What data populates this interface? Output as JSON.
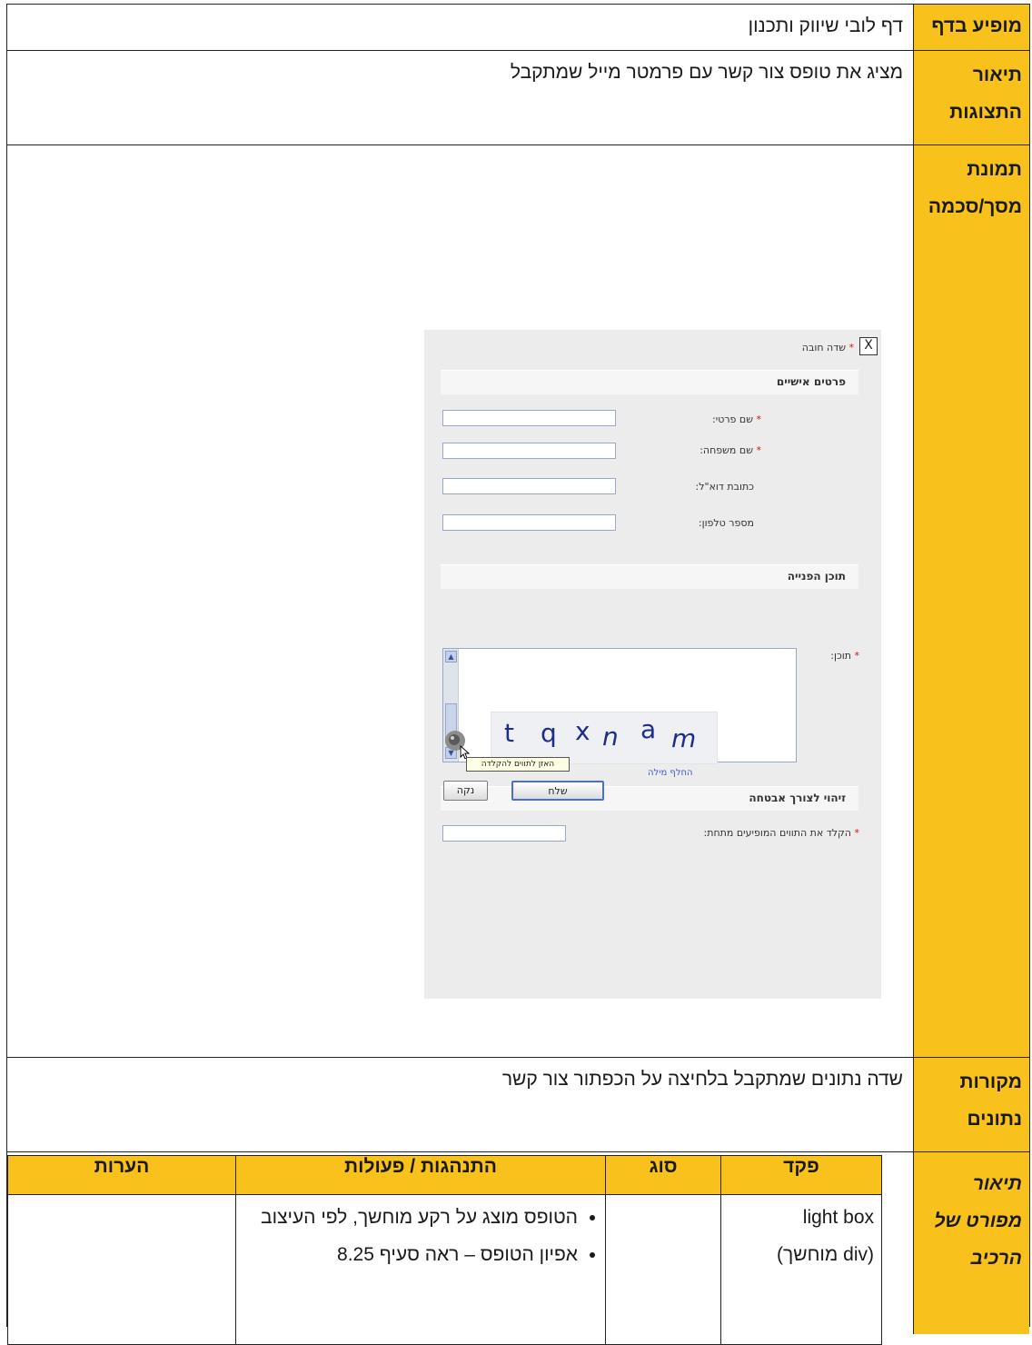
{
  "rows": {
    "appears_in": {
      "label": "מופיע בדף",
      "value": "דף לובי שיווק ותכנון"
    },
    "behaviors": {
      "label1": "תיאור",
      "label2": "התצוגות",
      "value": "מציג את טופס צור קשר עם פרמטר מייל שמתקבל"
    },
    "screenshot": {
      "label1": "תמונת",
      "label2": "מסך/סכמה"
    },
    "data_sources": {
      "label1": "מקורות",
      "label2": "נתונים",
      "value": "שדה נתונים שמתקבל בלחיצה על הכפתור צור קשר"
    },
    "detail": {
      "label1": "תיאור",
      "label2": "מפורט של",
      "label3": "הרכיב"
    }
  },
  "form": {
    "close": "X",
    "required_note": "שדה חובה",
    "personal_section": "פרטים אישיים",
    "first_name": "שם פרטי:",
    "last_name": "שם משפחה:",
    "email": "כתובת דוא\"ל:",
    "phone": "מספר טלפון:",
    "content_section": "תוכן הפנייה",
    "content": "תוכן:",
    "security_section": "זיהוי לצורך אבטחה",
    "captcha_prompt": "הקלד את התווים המופיעים מתחת:",
    "captcha_chars": [
      "t",
      "q",
      "x",
      "n",
      "a",
      "m"
    ],
    "tooltip": "האזן לתווים להקלדה",
    "change_word": "החלף מילה",
    "send": "שלח",
    "clear": "נקה",
    "asterisk": "*"
  },
  "detail_table": {
    "headers": {
      "control": "פקד",
      "type": "סוג",
      "behavior": "התנהגות / פעולות",
      "notes": "הערות"
    },
    "row1": {
      "control_line1": "light box",
      "control_line2": "(div מוחשך)",
      "type": "",
      "bullet1": "הטופס מוצג על רקע מוחשך, לפי העיצוב",
      "bullet2": "אפיון הטופס – ראה סעיף 8.25",
      "notes": ""
    }
  }
}
